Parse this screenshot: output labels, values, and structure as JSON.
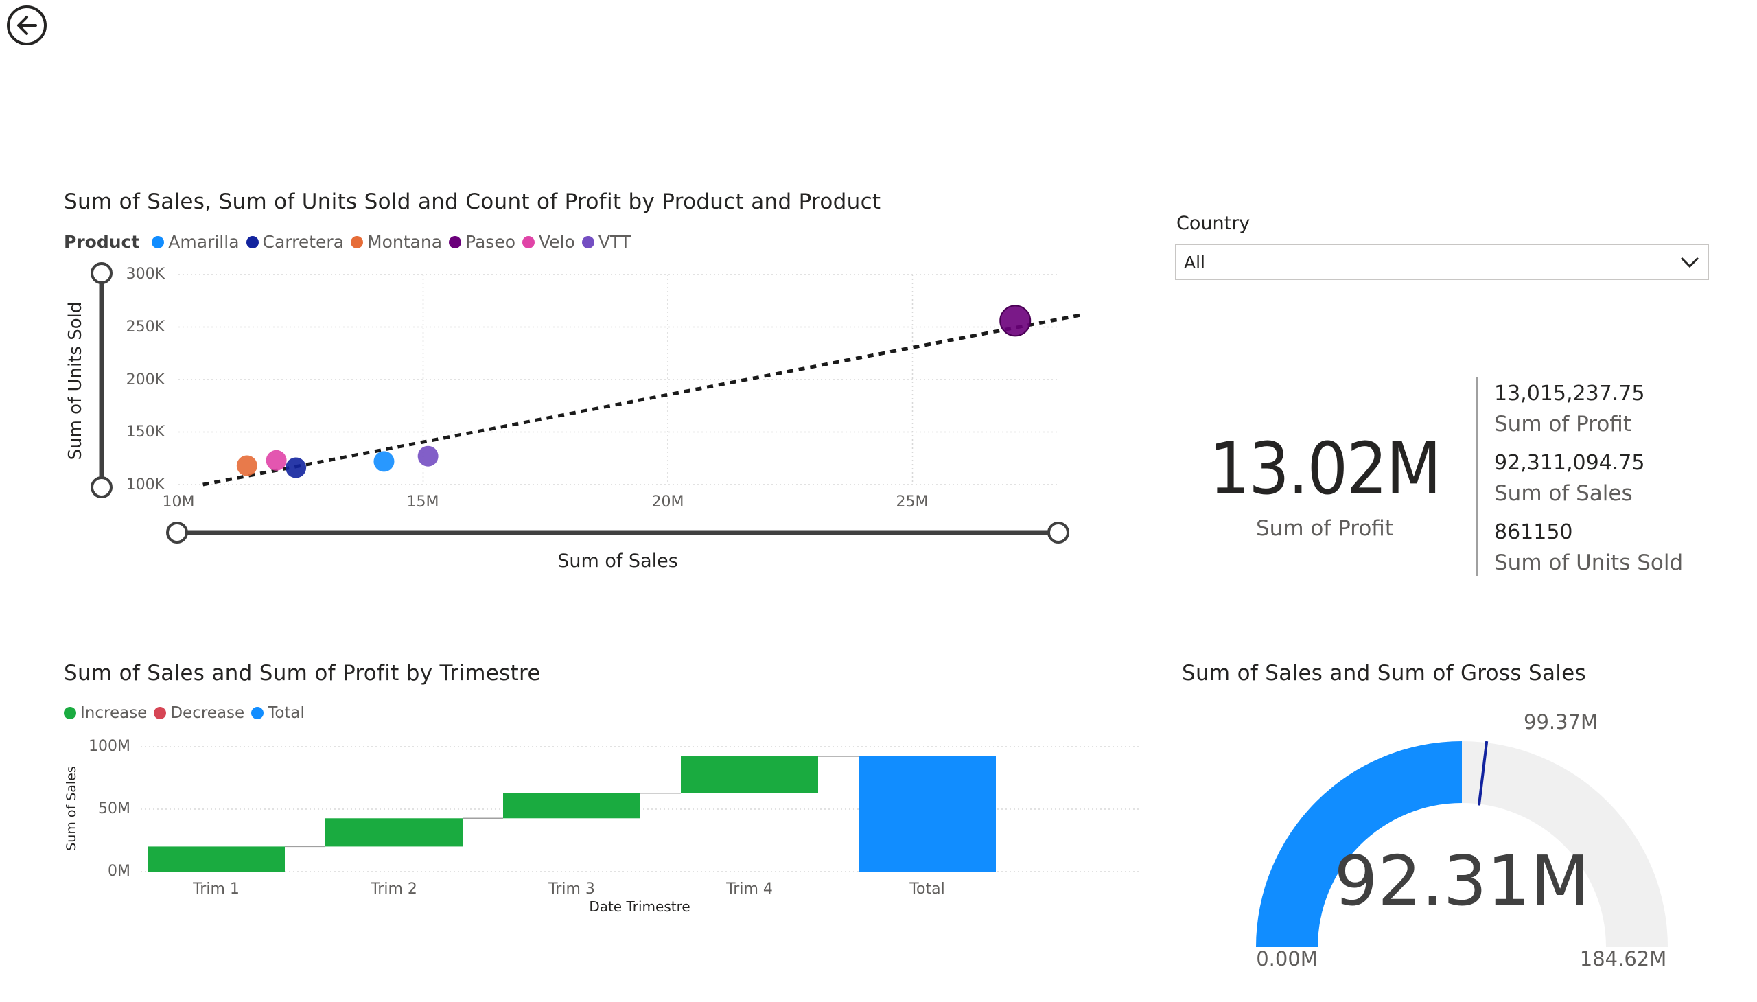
{
  "nav": {
    "back_icon": "back-arrow-icon"
  },
  "scatter": {
    "title": "Sum of Sales, Sum of Units Sold and Count of Profit by Product and Product",
    "legend_title": "Product",
    "legend": [
      {
        "label": "Amarilla",
        "color": "#118DFF"
      },
      {
        "label": "Carretera",
        "color": "#12239E"
      },
      {
        "label": "Montana",
        "color": "#E66C37"
      },
      {
        "label": "Paseo",
        "color": "#6B007B"
      },
      {
        "label": "Velo",
        "color": "#E044A7"
      },
      {
        "label": "VTT",
        "color": "#744EC2"
      }
    ],
    "y_ticks": [
      "300K",
      "250K",
      "200K",
      "150K",
      "100K"
    ],
    "x_ticks": [
      "10M",
      "15M",
      "20M",
      "25M"
    ]
  },
  "slicer": {
    "label": "Country",
    "value": "All"
  },
  "multirow": {
    "big_value": "13.02M",
    "big_label": "Sum of Profit",
    "rows": [
      {
        "value": "13,015,237.75",
        "label": "Sum of Profit"
      },
      {
        "value": "92,311,094.75",
        "label": "Sum of Sales"
      },
      {
        "value": "861150",
        "label": "Sum of Units Sold"
      }
    ]
  },
  "waterfall": {
    "title": "Sum of Sales and Sum of Profit by Trimestre",
    "legend": [
      {
        "label": "Increase",
        "color": "#1AAB40"
      },
      {
        "label": "Decrease",
        "color": "#D64554"
      },
      {
        "label": "Total",
        "color": "#118DFF"
      }
    ],
    "y_ticks": [
      "100M",
      "50M",
      "0M"
    ]
  },
  "gauge": {
    "title": "Sum of Sales and Sum of Gross Sales",
    "value_label": "92.31M",
    "target_label": "99.37M",
    "min_label": "0.00M",
    "max_label": "184.62M",
    "value": 92.31,
    "target": 99.37,
    "min": 0,
    "max": 184.62,
    "fill_color": "#118DFF",
    "track_color": "#F0F0F0",
    "target_color": "#12239E"
  },
  "chart_data": [
    {
      "type": "scatter",
      "title": "Sum of Sales, Sum of Units Sold and Count of Profit by Product and Product",
      "xlabel": "Sum of Sales",
      "ylabel": "Sum of Units Sold",
      "xlim": [
        10,
        28.5
      ],
      "ylim": [
        100000,
        300000
      ],
      "x_unit": "M",
      "grid": true,
      "legend_position": "top-left",
      "trend_line": true,
      "points": [
        {
          "series": "Montana",
          "x": 11.4,
          "y": 118000,
          "color": "#E66C37"
        },
        {
          "series": "Velo",
          "x": 12.0,
          "y": 123000,
          "color": "#E044A7"
        },
        {
          "series": "Carretera",
          "x": 12.4,
          "y": 116000,
          "color": "#12239E"
        },
        {
          "series": "Amarilla",
          "x": 14.2,
          "y": 122000,
          "color": "#118DFF"
        },
        {
          "series": "VTT",
          "x": 15.1,
          "y": 127000,
          "color": "#744EC2"
        },
        {
          "series": "Paseo",
          "x": 27.1,
          "y": 256000,
          "color": "#6B007B"
        }
      ],
      "trend": {
        "x": [
          10.5,
          28.5
        ],
        "y": [
          100000,
          262000
        ]
      }
    },
    {
      "type": "bar",
      "subtype": "waterfall",
      "title": "Sum of Sales and Sum of Profit by Trimestre",
      "xlabel": "Date Trimestre",
      "ylabel": "Sum of Sales",
      "categories": [
        "Trim 1",
        "Trim 2",
        "Trim 3",
        "Trim 4",
        "Total"
      ],
      "values": [
        20.1,
        22.6,
        20.1,
        29.5,
        92.31
      ],
      "ylim": [
        0,
        100
      ],
      "y_unit": "M",
      "grid": true,
      "legend_position": "top-left"
    }
  ]
}
